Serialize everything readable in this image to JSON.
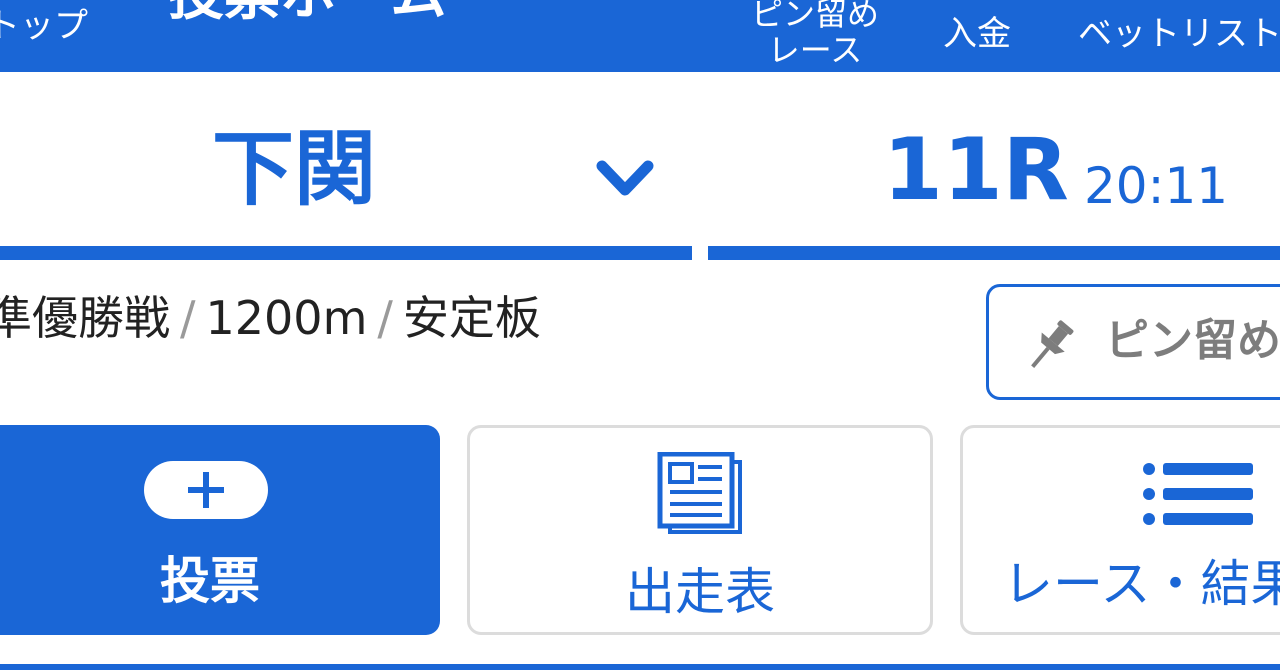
{
  "header": {
    "top_label": "トップ",
    "title_fragment": "投票ホーム",
    "pin_race_line1": "ピン留め",
    "pin_race_line2": "レース",
    "deposit_label": "入金",
    "betlist_label": "ベットリスト"
  },
  "venue_selector": {
    "venue": "下関",
    "icon": "chevron-down-icon"
  },
  "race_selector": {
    "race": "11R",
    "time": "20:11"
  },
  "race_info": {
    "grade": "準優勝戦",
    "distance": "1200m",
    "motor": "安定板"
  },
  "pin_button": {
    "label": "ピン留め",
    "icon": "pushpin-icon"
  },
  "tiles": {
    "bet": {
      "label": "投票",
      "icon": "plus-icon"
    },
    "entry_list": {
      "label": "出走表",
      "icon": "newspaper-icon"
    },
    "results": {
      "label": "レース・結果",
      "icon": "list-icon"
    }
  },
  "colors": {
    "accent": "#1a66d6",
    "text": "#222222",
    "muted": "#7d7d7d",
    "border": "#dcdcdc"
  }
}
